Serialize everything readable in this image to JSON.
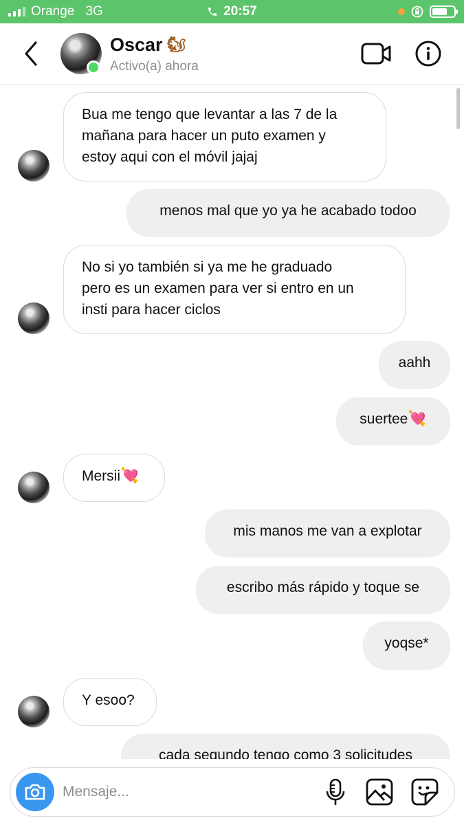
{
  "status_bar": {
    "carrier": "Orange",
    "network": "3G",
    "time": "20:57",
    "battery_level": 0.7,
    "colors": {
      "background": "#5cc46a"
    }
  },
  "header": {
    "contact_name": "Oscar",
    "name_emoji": "🐿",
    "status_text": "Activo(a) ahora",
    "icons": [
      "back-icon",
      "video-call-icon",
      "info-icon"
    ]
  },
  "messages": [
    {
      "direction": "in",
      "text": "Bua me tengo que levantar a las 7 de la mañana para hacer un puto examen y estoy aqui con el móvil jajaj",
      "lines": [
        "Bua me tengo que levantar a las 7 de la",
        "mañana para hacer un puto examen y",
        "estoy aqui con el móvil jajaj"
      ]
    },
    {
      "direction": "out",
      "text": "menos mal que yo ya he acabado todoo"
    },
    {
      "direction": "in",
      "text": "No si yo también si ya me he graduado pero es un examen para ver si entro en un insti para hacer ciclos",
      "lines": [
        "No si yo también si ya me he graduado",
        "pero es un examen para ver si entro en un",
        "insti para hacer ciclos"
      ]
    },
    {
      "direction": "out",
      "text": "aahh"
    },
    {
      "direction": "out",
      "text": "suertee",
      "emoji": "💘"
    },
    {
      "direction": "in",
      "text": "Mersii",
      "emoji": "💘"
    },
    {
      "direction": "out",
      "text": "mis manos me van a explotar"
    },
    {
      "direction": "out",
      "text": "escribo más rápido y toque se"
    },
    {
      "direction": "out",
      "text": "yoqse*"
    },
    {
      "direction": "in",
      "text": "Y esoo?"
    },
    {
      "direction": "out",
      "text": "cada segundo tengo como 3 solicitudes"
    }
  ],
  "composer": {
    "placeholder": "Mensaje...",
    "value": "",
    "icons": [
      "camera-icon",
      "microphone-icon",
      "gallery-icon",
      "sticker-icon"
    ],
    "colors": {
      "camera_button": "#3a97f0"
    }
  },
  "colors": {
    "incoming_bubble": "#ffffff",
    "outgoing_bubble": "#efefef",
    "online_indicator": "#4cd964"
  }
}
